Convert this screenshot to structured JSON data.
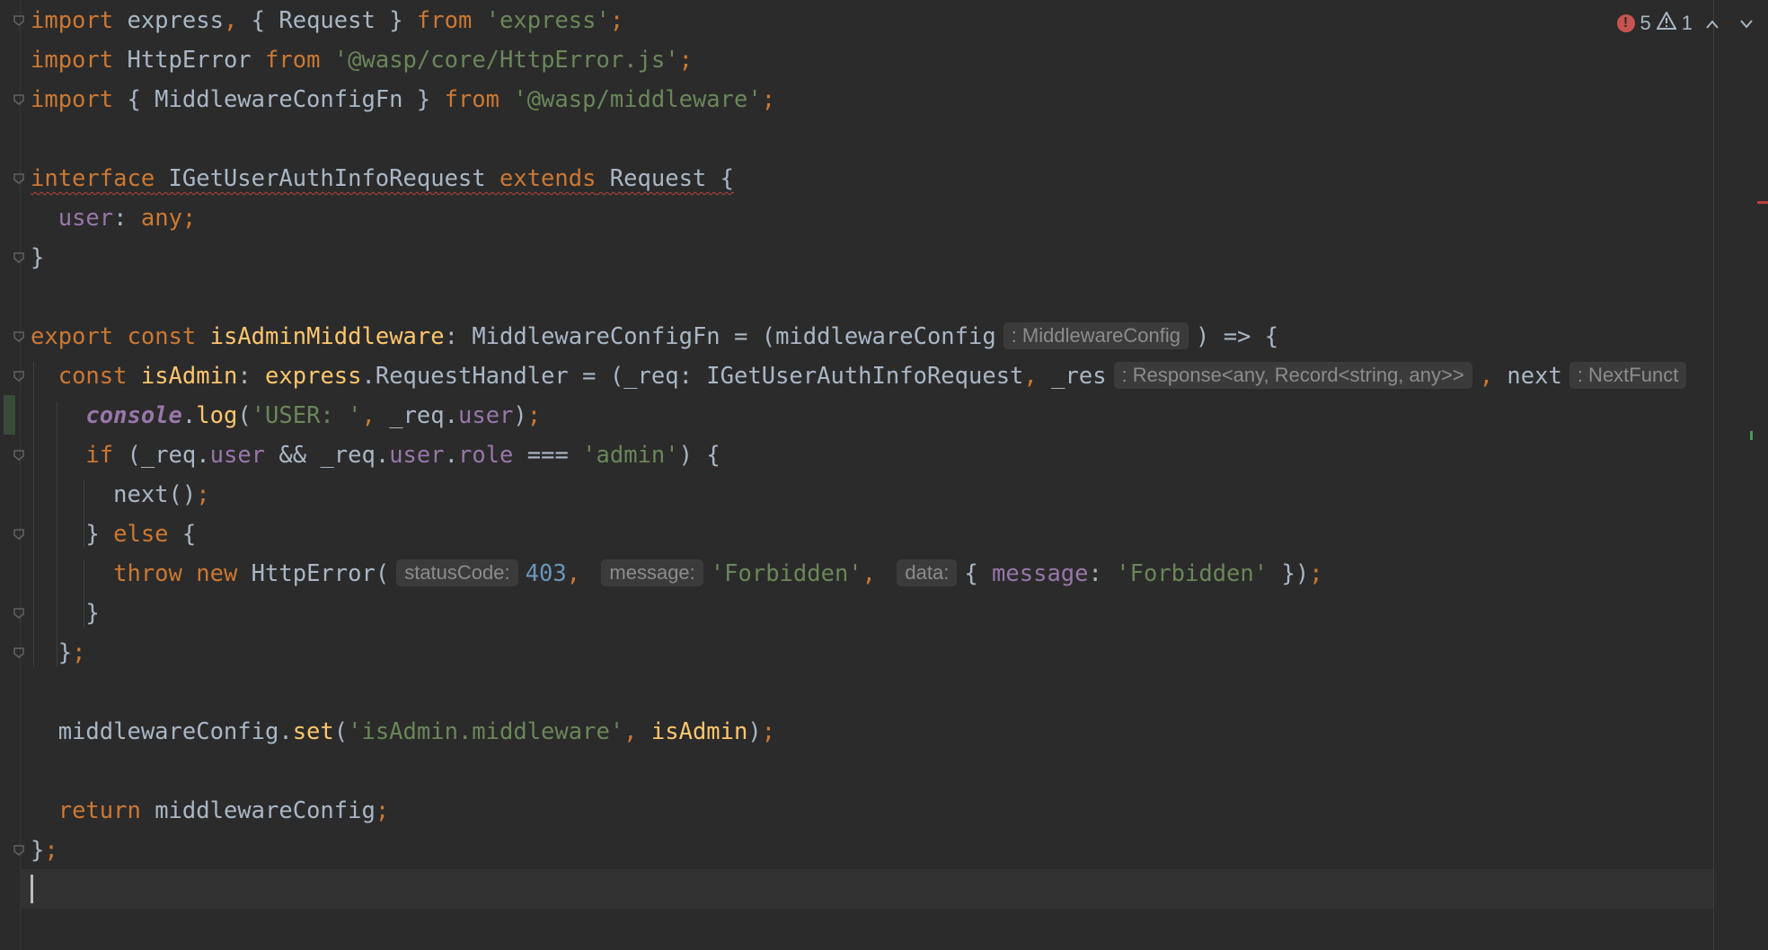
{
  "editor": {
    "language": "typescript",
    "status": {
      "errors": "5",
      "warnings": "1"
    },
    "lines": [
      {
        "tokens": [
          [
            "kw",
            "import"
          ],
          [
            "tx",
            " express"
          ],
          [
            "punc",
            ","
          ],
          [
            "tx",
            " { Request } "
          ],
          [
            "kw",
            "from"
          ],
          [
            "tx",
            " "
          ],
          [
            "str",
            "'express'"
          ],
          [
            "punc",
            ";"
          ]
        ]
      },
      {
        "tokens": [
          [
            "kw",
            "import"
          ],
          [
            "tx",
            " HttpError "
          ],
          [
            "kw",
            "from"
          ],
          [
            "tx",
            " "
          ],
          [
            "str",
            "'@wasp/core/HttpError.js'"
          ],
          [
            "punc",
            ";"
          ]
        ]
      },
      {
        "tokens": [
          [
            "kw",
            "import"
          ],
          [
            "tx",
            " { MiddlewareConfigFn } "
          ],
          [
            "kw",
            "from"
          ],
          [
            "tx",
            " "
          ],
          [
            "str",
            "'@wasp/middleware'"
          ],
          [
            "punc",
            ";"
          ]
        ]
      },
      {
        "tokens": []
      },
      {
        "tokens": [
          [
            "kw err-wave",
            "interface"
          ],
          [
            "tx err-wave",
            " IGetUserAuthInfoRequest "
          ],
          [
            "kw err-wave",
            "extends"
          ],
          [
            "tx err-wave",
            " Request {"
          ]
        ]
      },
      {
        "tokens": [
          [
            "tx",
            "  "
          ],
          [
            "prop",
            "user"
          ],
          [
            "tx",
            ": "
          ],
          [
            "kw",
            "any"
          ],
          [
            "punc",
            ";"
          ]
        ]
      },
      {
        "tokens": [
          [
            "tx",
            "}"
          ]
        ]
      },
      {
        "tokens": []
      },
      {
        "tokens": [
          [
            "kw",
            "export"
          ],
          [
            "tx",
            " "
          ],
          [
            "kw",
            "const"
          ],
          [
            "tx",
            " "
          ],
          [
            "fn",
            "isAdminMiddleware"
          ],
          [
            "tx",
            ": MiddlewareConfigFn = (middlewareConfig"
          ],
          [
            "hint",
            ": MiddlewareConfig"
          ],
          [
            "tx",
            ") => {"
          ]
        ]
      },
      {
        "tokens": [
          [
            "tx",
            "  "
          ],
          [
            "kw",
            "const"
          ],
          [
            "tx",
            " "
          ],
          [
            "fn",
            "isAdmin"
          ],
          [
            "tx",
            ": "
          ],
          [
            "fn",
            "express"
          ],
          [
            "tx",
            ".RequestHandler = (_req: IGetUserAuthInfoRequest"
          ],
          [
            "punc",
            ","
          ],
          [
            "tx",
            " _res"
          ],
          [
            "hint",
            ": Response<any, Record<string, any>>"
          ],
          [
            "punc",
            ","
          ],
          [
            "tx",
            " next"
          ],
          [
            "hint",
            ": NextFunct"
          ]
        ]
      },
      {
        "tokens": [
          [
            "tx",
            "    "
          ],
          [
            "glob",
            "console"
          ],
          [
            "tx",
            "."
          ],
          [
            "fn",
            "log"
          ],
          [
            "tx",
            "("
          ],
          [
            "str",
            "'USER: '"
          ],
          [
            "punc",
            ","
          ],
          [
            "tx",
            " _req."
          ],
          [
            "prop",
            "user"
          ],
          [
            "tx",
            ")"
          ],
          [
            "punc",
            ";"
          ]
        ]
      },
      {
        "tokens": [
          [
            "tx",
            "    "
          ],
          [
            "kw",
            "if"
          ],
          [
            "tx",
            " (_req."
          ],
          [
            "prop",
            "user"
          ],
          [
            "tx",
            " && _req."
          ],
          [
            "prop",
            "user"
          ],
          [
            "tx",
            "."
          ],
          [
            "prop",
            "role"
          ],
          [
            "tx",
            " === "
          ],
          [
            "str",
            "'admin'"
          ],
          [
            "tx",
            ") {"
          ]
        ]
      },
      {
        "tokens": [
          [
            "tx",
            "      next()"
          ],
          [
            "punc",
            ";"
          ]
        ]
      },
      {
        "tokens": [
          [
            "tx",
            "    } "
          ],
          [
            "kw",
            "else"
          ],
          [
            "tx",
            " {"
          ]
        ]
      },
      {
        "tokens": [
          [
            "tx",
            "      "
          ],
          [
            "kw",
            "throw"
          ],
          [
            "tx",
            " "
          ],
          [
            "kw",
            "new"
          ],
          [
            "tx",
            " HttpError("
          ],
          [
            "hint",
            "statusCode:"
          ],
          [
            "num",
            "403"
          ],
          [
            "punc",
            ","
          ],
          [
            "tx",
            " "
          ],
          [
            "hint",
            "message:"
          ],
          [
            "str",
            "'Forbidden'"
          ],
          [
            "punc",
            ","
          ],
          [
            "tx",
            " "
          ],
          [
            "hint",
            "data:"
          ],
          [
            "tx",
            "{ "
          ],
          [
            "prop",
            "message"
          ],
          [
            "tx",
            ": "
          ],
          [
            "str",
            "'Forbidden'"
          ],
          [
            "tx",
            " })"
          ],
          [
            "punc",
            ";"
          ]
        ]
      },
      {
        "tokens": [
          [
            "tx",
            "    }"
          ]
        ]
      },
      {
        "tokens": [
          [
            "tx",
            "  }"
          ],
          [
            "punc",
            ";"
          ]
        ]
      },
      {
        "tokens": []
      },
      {
        "tokens": [
          [
            "tx",
            "  middlewareConfig."
          ],
          [
            "fn",
            "set"
          ],
          [
            "tx",
            "("
          ],
          [
            "str",
            "'isAdmin.middleware'"
          ],
          [
            "punc",
            ","
          ],
          [
            "tx",
            " "
          ],
          [
            "fn",
            "isAdmin"
          ],
          [
            "tx",
            ")"
          ],
          [
            "punc",
            ";"
          ]
        ]
      },
      {
        "tokens": []
      },
      {
        "tokens": [
          [
            "tx",
            "  "
          ],
          [
            "kw",
            "return"
          ],
          [
            "tx",
            " middlewareConfig"
          ],
          [
            "punc",
            ";"
          ]
        ]
      },
      {
        "tokens": [
          [
            "tx",
            "}"
          ],
          [
            "punc",
            ";"
          ]
        ]
      },
      {
        "tokens": []
      }
    ]
  }
}
